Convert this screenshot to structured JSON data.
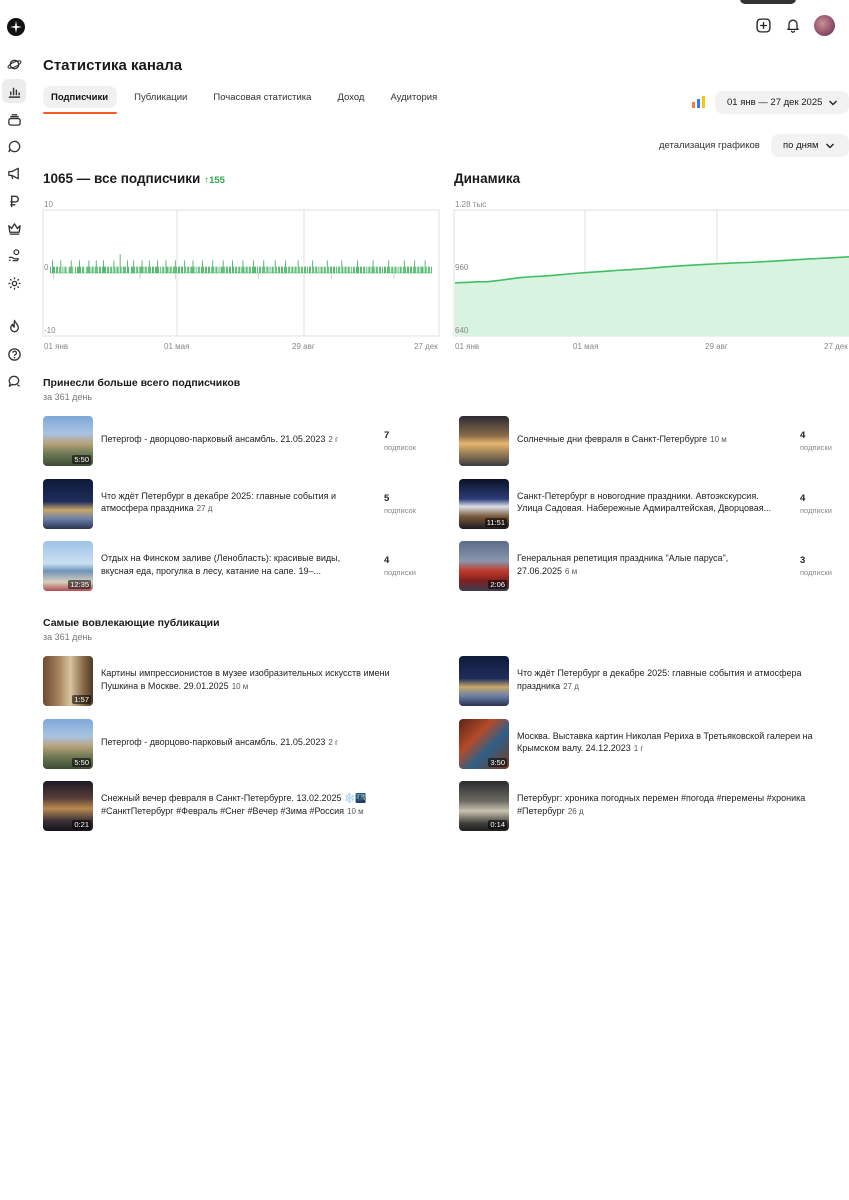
{
  "header": {
    "title": "Статистика канала",
    "tabs": [
      "Подписчики",
      "Публикации",
      "Почасовая статистика",
      "Доход",
      "Аудитория"
    ],
    "date_range": "01 янв — 27 дек 2025",
    "detail_label": "детализация графиков",
    "detail_value": "по дням"
  },
  "icons": {
    "topbar": [
      "add-icon",
      "bell-icon",
      "avatar"
    ],
    "rail": [
      "planet-icon",
      "stats-icon",
      "layers-icon",
      "comment-icon",
      "megaphone-icon",
      "ruble-icon",
      "crown-icon",
      "hand-coin-icon",
      "gear-icon",
      "fire-icon",
      "help-icon",
      "chat-icon"
    ]
  },
  "subscribers_chart": {
    "title": "1065 — все подписчики",
    "delta": "155",
    "delta_color": "#2fa84f"
  },
  "dynamics_chart": {
    "title": "Динамика"
  },
  "chart_data": [
    {
      "type": "bar",
      "x_ticks": [
        "01 янв",
        "01 мая",
        "29 авг",
        "27 дек"
      ],
      "y_ticks": [
        "10",
        "0",
        "-10"
      ],
      "ylim": [
        -10,
        10
      ],
      "daily_values": [
        1,
        0,
        2,
        1,
        1,
        0,
        1,
        1,
        0,
        1,
        2,
        0,
        1,
        0,
        1,
        1,
        0,
        0,
        1,
        1,
        2,
        1,
        0,
        0,
        1,
        0,
        1,
        1,
        2,
        1,
        0,
        1,
        1,
        0,
        0,
        1,
        1,
        2,
        1,
        0,
        1,
        1,
        0,
        1,
        2,
        1,
        0,
        1,
        1,
        0,
        1,
        2,
        1,
        1,
        0,
        1,
        1,
        0,
        1,
        1,
        0,
        2,
        1,
        0,
        1,
        1,
        0,
        3,
        1,
        0,
        1,
        1,
        1,
        0,
        2,
        1,
        0,
        0,
        1,
        1,
        2,
        1,
        0,
        1,
        1,
        0,
        1,
        1,
        2,
        1,
        0,
        1,
        1,
        0,
        1,
        2,
        1,
        0,
        1,
        1,
        0,
        1,
        1,
        2,
        1,
        0,
        1,
        0,
        1,
        1,
        0,
        2,
        1,
        1,
        0,
        1,
        1,
        0,
        1,
        1,
        2,
        1,
        0,
        1,
        1,
        0,
        1,
        1,
        0,
        2,
        1,
        0,
        1,
        1,
        0,
        1,
        1,
        2,
        1,
        0,
        1,
        0,
        1,
        1,
        0,
        1,
        2,
        1,
        0,
        1,
        1,
        0,
        1,
        1,
        0,
        1,
        2,
        1,
        0,
        1,
        1,
        0,
        1,
        0,
        1,
        1,
        2,
        1,
        0,
        1,
        1,
        0,
        1,
        1,
        0,
        2,
        1,
        0,
        1,
        1,
        0,
        1,
        1,
        0,
        1,
        2,
        1,
        0,
        1,
        1,
        0,
        1,
        1,
        0,
        1,
        2,
        1,
        1,
        0,
        1,
        0,
        1,
        1,
        0,
        1,
        2,
        1,
        0,
        1,
        1,
        0,
        1,
        0,
        1,
        1,
        0,
        2,
        1,
        0,
        1,
        1,
        0,
        1,
        1,
        0,
        1,
        2,
        1,
        0,
        1,
        1,
        0,
        1,
        1,
        0,
        1,
        1,
        0,
        2,
        1,
        0,
        1,
        1,
        0,
        1,
        1,
        0,
        1,
        0,
        1,
        1,
        0,
        2,
        1,
        0,
        1,
        1,
        0,
        1,
        0,
        1,
        1,
        0,
        1,
        1,
        0,
        2,
        1,
        0,
        1,
        1,
        0,
        1,
        1,
        0,
        1,
        0,
        1,
        1,
        0,
        2,
        1,
        0,
        1,
        1,
        0,
        1,
        1,
        0,
        1,
        0,
        1,
        1,
        0,
        1,
        2,
        1,
        0,
        1,
        1,
        0,
        1,
        1,
        0,
        1,
        0,
        1,
        1,
        0,
        1,
        2,
        1,
        0,
        1,
        1,
        0,
        1,
        1,
        0,
        1,
        0,
        1,
        1,
        0,
        1,
        2,
        1,
        0,
        1,
        1,
        0,
        1,
        1,
        0,
        1,
        0,
        1,
        1,
        0,
        1,
        2,
        1,
        0,
        1,
        1,
        0,
        1,
        1,
        0,
        1,
        2,
        1,
        0,
        1,
        1,
        0,
        1,
        1,
        1,
        0,
        2,
        1,
        0,
        1,
        1,
        0,
        1
      ],
      "negative_days": [
        3,
        86,
        120,
        200,
        270,
        330
      ],
      "bar_color": "#2fa84f"
    },
    {
      "type": "area",
      "x_ticks": [
        "01 янв",
        "01 мая",
        "29 авг",
        "27 дек"
      ],
      "y_ticks": [
        "1.28 тыс",
        "960",
        "640"
      ],
      "ylim": [
        640,
        1280
      ],
      "x": [
        0,
        10,
        20,
        30,
        40,
        50,
        60,
        70,
        80,
        90,
        100,
        110,
        120,
        130,
        140,
        150,
        160,
        170,
        180,
        190,
        200,
        210,
        220,
        230,
        240,
        250,
        260,
        270,
        280,
        290,
        300,
        310,
        320,
        330,
        340,
        350,
        360
      ],
      "values": [
        910,
        912,
        915,
        916,
        922,
        930,
        937,
        941,
        944,
        948,
        953,
        958,
        962,
        966,
        970,
        974,
        977,
        981,
        985,
        990,
        994,
        998,
        1001,
        1004,
        1007,
        1010,
        1012,
        1014,
        1017,
        1020,
        1023,
        1027,
        1030,
        1033,
        1036,
        1039,
        1042
      ],
      "line_color": "#3fbf62",
      "fill_color": "#d9f3e1"
    }
  ],
  "top_subscribers": {
    "title": "Принесли больше всего подписчиков",
    "subtitle": "за 361 день",
    "unit_many": "подписок",
    "unit_other": "подписки",
    "left": [
      {
        "title": "Петергоф - дворцово-парковый ансамбль. 21.05.2023",
        "age": "2 г",
        "count": "7",
        "unit": "подписок",
        "duration": "5:50",
        "thumb": "peterhof"
      },
      {
        "title": "Что ждёт Петербург в декабре 2025: главные события и атмосфера праздника",
        "age": "27 д",
        "count": "5",
        "unit": "подписок",
        "duration": "",
        "thumb": "night"
      },
      {
        "title": "Отдых на Финском заливе (Ленобласть): красивые виды, вкусная еда, прогулка в лесу, катание на сапе. 19–...",
        "age": "",
        "count": "4",
        "unit": "подписки",
        "duration": "12:35",
        "thumb": "sea"
      }
    ],
    "right": [
      {
        "title": "Солнечные дни февраля в Санкт-Петербурге",
        "age": "10 м",
        "count": "4",
        "unit": "подписки",
        "duration": "",
        "thumb": "ice"
      },
      {
        "title": "Санкт-Петербург в новогодние праздники. Автоэкскурсия. Улица Садовая. Набережные Адмиралтейская, Дворцовая...",
        "age": "",
        "count": "4",
        "unit": "подписки",
        "duration": "11:51",
        "thumb": "lights"
      },
      {
        "title": "Генеральная репетиция праздника \"Алые паруса\", 27.06.2025",
        "age": "6 м",
        "count": "3",
        "unit": "подписки",
        "duration": "2:06",
        "thumb": "ship"
      }
    ]
  },
  "engaging": {
    "title": "Самые вовлекающие публикации",
    "subtitle": "за 361 день",
    "left": [
      {
        "title": "Картины импрессионистов в музее изобразительных искусств имени Пушкина в Москве. 29.01.2025",
        "age": "10 м",
        "duration": "1:57",
        "thumb": "museum"
      },
      {
        "title": "Петергоф - дворцово-парковый ансамбль. 21.05.2023",
        "age": "2 г",
        "duration": "5:50",
        "thumb": "peterhof"
      },
      {
        "title": "Снежный вечер февраля в Санкт-Петербурге. 13.02.2025 ❄️🌃 #СанктПетербург #Февраль #Снег #Вечер #Зима #Россия",
        "age": "10 м",
        "duration": "0:21",
        "thumb": "snow"
      }
    ],
    "right": [
      {
        "title": "Что ждёт Петербург в декабре 2025: главные события и атмосфера праздника",
        "age": "27 д",
        "duration": "",
        "thumb": "night"
      },
      {
        "title": "Москва. Выставка картин Николая Рериха в Третьяковской галереи на Крымском валу. 24.12.2023",
        "age": "1 г",
        "duration": "3:50",
        "thumb": "painting"
      },
      {
        "title": "Петербург: хроника погодных перемен #погода #перемены #хроника #Петербург",
        "age": "26 д",
        "duration": "0:14",
        "thumb": "statue"
      }
    ]
  }
}
